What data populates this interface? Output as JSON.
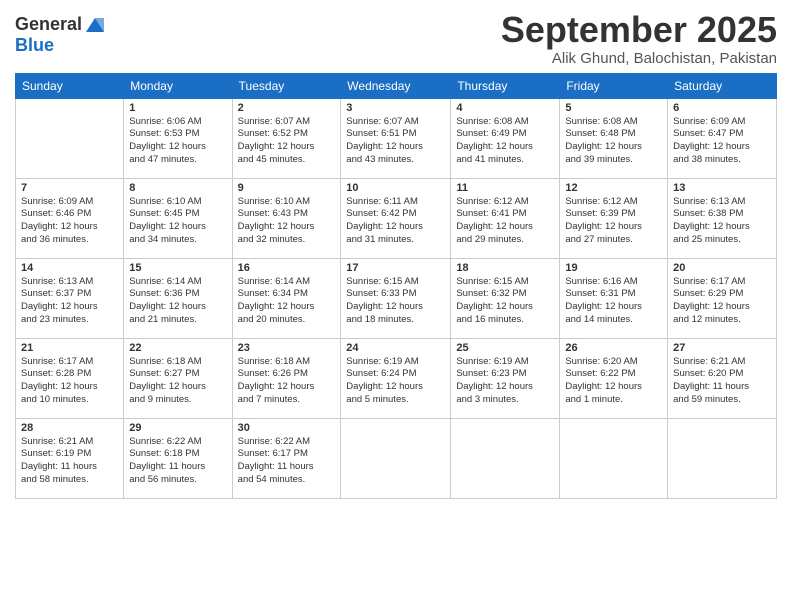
{
  "logo": {
    "general": "General",
    "blue": "Blue"
  },
  "header": {
    "title": "September 2025",
    "subtitle": "Alik Ghund, Balochistan, Pakistan"
  },
  "days_of_week": [
    "Sunday",
    "Monday",
    "Tuesday",
    "Wednesday",
    "Thursday",
    "Friday",
    "Saturday"
  ],
  "weeks": [
    [
      {
        "day": "",
        "info": ""
      },
      {
        "day": "1",
        "info": "Sunrise: 6:06 AM\nSunset: 6:53 PM\nDaylight: 12 hours\nand 47 minutes."
      },
      {
        "day": "2",
        "info": "Sunrise: 6:07 AM\nSunset: 6:52 PM\nDaylight: 12 hours\nand 45 minutes."
      },
      {
        "day": "3",
        "info": "Sunrise: 6:07 AM\nSunset: 6:51 PM\nDaylight: 12 hours\nand 43 minutes."
      },
      {
        "day": "4",
        "info": "Sunrise: 6:08 AM\nSunset: 6:49 PM\nDaylight: 12 hours\nand 41 minutes."
      },
      {
        "day": "5",
        "info": "Sunrise: 6:08 AM\nSunset: 6:48 PM\nDaylight: 12 hours\nand 39 minutes."
      },
      {
        "day": "6",
        "info": "Sunrise: 6:09 AM\nSunset: 6:47 PM\nDaylight: 12 hours\nand 38 minutes."
      }
    ],
    [
      {
        "day": "7",
        "info": "Sunrise: 6:09 AM\nSunset: 6:46 PM\nDaylight: 12 hours\nand 36 minutes."
      },
      {
        "day": "8",
        "info": "Sunrise: 6:10 AM\nSunset: 6:45 PM\nDaylight: 12 hours\nand 34 minutes."
      },
      {
        "day": "9",
        "info": "Sunrise: 6:10 AM\nSunset: 6:43 PM\nDaylight: 12 hours\nand 32 minutes."
      },
      {
        "day": "10",
        "info": "Sunrise: 6:11 AM\nSunset: 6:42 PM\nDaylight: 12 hours\nand 31 minutes."
      },
      {
        "day": "11",
        "info": "Sunrise: 6:12 AM\nSunset: 6:41 PM\nDaylight: 12 hours\nand 29 minutes."
      },
      {
        "day": "12",
        "info": "Sunrise: 6:12 AM\nSunset: 6:39 PM\nDaylight: 12 hours\nand 27 minutes."
      },
      {
        "day": "13",
        "info": "Sunrise: 6:13 AM\nSunset: 6:38 PM\nDaylight: 12 hours\nand 25 minutes."
      }
    ],
    [
      {
        "day": "14",
        "info": "Sunrise: 6:13 AM\nSunset: 6:37 PM\nDaylight: 12 hours\nand 23 minutes."
      },
      {
        "day": "15",
        "info": "Sunrise: 6:14 AM\nSunset: 6:36 PM\nDaylight: 12 hours\nand 21 minutes."
      },
      {
        "day": "16",
        "info": "Sunrise: 6:14 AM\nSunset: 6:34 PM\nDaylight: 12 hours\nand 20 minutes."
      },
      {
        "day": "17",
        "info": "Sunrise: 6:15 AM\nSunset: 6:33 PM\nDaylight: 12 hours\nand 18 minutes."
      },
      {
        "day": "18",
        "info": "Sunrise: 6:15 AM\nSunset: 6:32 PM\nDaylight: 12 hours\nand 16 minutes."
      },
      {
        "day": "19",
        "info": "Sunrise: 6:16 AM\nSunset: 6:31 PM\nDaylight: 12 hours\nand 14 minutes."
      },
      {
        "day": "20",
        "info": "Sunrise: 6:17 AM\nSunset: 6:29 PM\nDaylight: 12 hours\nand 12 minutes."
      }
    ],
    [
      {
        "day": "21",
        "info": "Sunrise: 6:17 AM\nSunset: 6:28 PM\nDaylight: 12 hours\nand 10 minutes."
      },
      {
        "day": "22",
        "info": "Sunrise: 6:18 AM\nSunset: 6:27 PM\nDaylight: 12 hours\nand 9 minutes."
      },
      {
        "day": "23",
        "info": "Sunrise: 6:18 AM\nSunset: 6:26 PM\nDaylight: 12 hours\nand 7 minutes."
      },
      {
        "day": "24",
        "info": "Sunrise: 6:19 AM\nSunset: 6:24 PM\nDaylight: 12 hours\nand 5 minutes."
      },
      {
        "day": "25",
        "info": "Sunrise: 6:19 AM\nSunset: 6:23 PM\nDaylight: 12 hours\nand 3 minutes."
      },
      {
        "day": "26",
        "info": "Sunrise: 6:20 AM\nSunset: 6:22 PM\nDaylight: 12 hours\nand 1 minute."
      },
      {
        "day": "27",
        "info": "Sunrise: 6:21 AM\nSunset: 6:20 PM\nDaylight: 11 hours\nand 59 minutes."
      }
    ],
    [
      {
        "day": "28",
        "info": "Sunrise: 6:21 AM\nSunset: 6:19 PM\nDaylight: 11 hours\nand 58 minutes."
      },
      {
        "day": "29",
        "info": "Sunrise: 6:22 AM\nSunset: 6:18 PM\nDaylight: 11 hours\nand 56 minutes."
      },
      {
        "day": "30",
        "info": "Sunrise: 6:22 AM\nSunset: 6:17 PM\nDaylight: 11 hours\nand 54 minutes."
      },
      {
        "day": "",
        "info": ""
      },
      {
        "day": "",
        "info": ""
      },
      {
        "day": "",
        "info": ""
      },
      {
        "day": "",
        "info": ""
      }
    ]
  ]
}
